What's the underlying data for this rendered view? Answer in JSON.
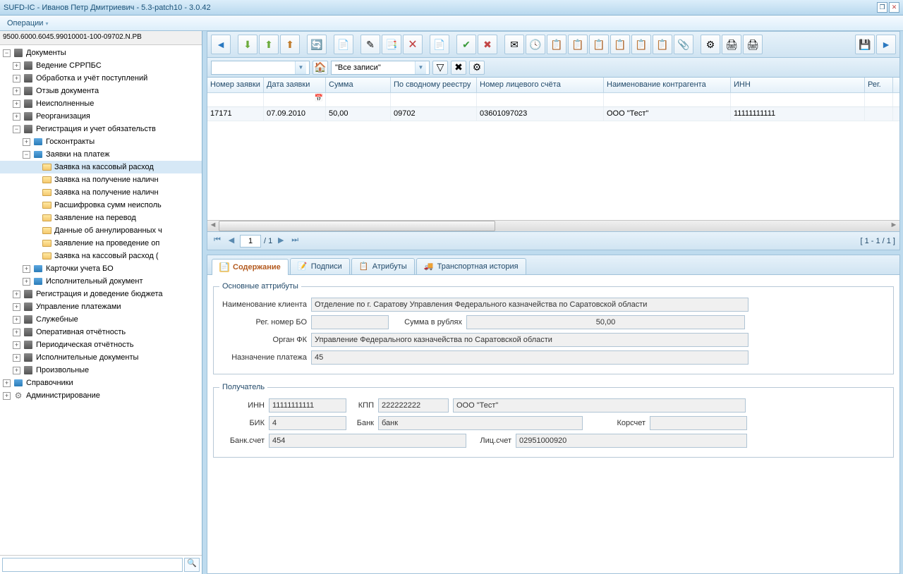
{
  "title": "SUFD-IC - Иванов Петр Дмитриевич - 5.3-patch10 - 3.0.42",
  "menu": {
    "operations": "Операции"
  },
  "tree": {
    "header": "9500.6000.6045.99010001-100-09702.N.PB",
    "root": "Документы",
    "admin": "Администрирование",
    "refs": "Справочники",
    "nodes": {
      "n1": "Ведение СРРПБС",
      "n2": "Обработка и учёт поступлений",
      "n3": "Отзыв документа",
      "n4": "Неисполненные",
      "n5": "Реорганизация",
      "n6": "Регистрация и учет обязательств",
      "n6a": "Госконтракты",
      "n6b": "Заявки на платеж",
      "n6b1": "Заявка на кассовый расход",
      "n6b2": "Заявка на получение наличн",
      "n6b3": "Заявка на получение наличн",
      "n6b4": "Расшифровка сумм неисполь",
      "n6b5": "Заявление на перевод",
      "n6b6": "Данные об аннулированных ч",
      "n6b7": "Заявление на проведение оп",
      "n6b8": "Заявка на кассовый расход (",
      "n6c": "Карточки учета БО",
      "n6d": "Исполнительный документ",
      "n7": "Регистрация и доведение бюджета",
      "n8": "Управление платежами",
      "n9": "Служебные",
      "n10": "Оперативная отчётность",
      "n11": "Периодическая отчётность",
      "n12": "Исполнительные документы",
      "n13": "Произвольные"
    }
  },
  "filter": {
    "allRecords": "\"Все записи\""
  },
  "grid": {
    "headers": {
      "num": "Номер заявки",
      "date": "Дата заявки",
      "sum": "Сумма",
      "reg": "По сводному реестру",
      "acct": "Номер лицевого счёта",
      "contr": "Наименование контрагента",
      "inn": "ИНН",
      "regcol": "Рег."
    },
    "row": {
      "num": "17171",
      "date": "07.09.2010",
      "sum": "50,00",
      "reg": "09702",
      "acct": "03601097023",
      "contr": "ООО \"Тест\"",
      "inn": "11111111111"
    }
  },
  "pager": {
    "page": "1",
    "of": "/ 1",
    "info": "[ 1 - 1 / 1 ]"
  },
  "tabs": {
    "t1": "Содержание",
    "t2": "Подписи",
    "t3": "Атрибуты",
    "t4": "Транспортная история"
  },
  "main": {
    "legend": "Основные аттрибуты",
    "clientLabel": "Наименование клиента",
    "client": "Отделение по г. Саратову Управления Федерального казначейства по Саратовской области",
    "regLabel": "Рег. номер БО",
    "reg": "",
    "sumLabel": "Сумма в рублях",
    "sum": "50,00",
    "organLabel": "Орган ФК",
    "organ": "Управление Федерального казначейства по Саратовской области",
    "purposeLabel": "Назначение платежа",
    "purpose": "45"
  },
  "rcpt": {
    "legend": "Получатель",
    "innLabel": "ИНН",
    "inn": "11111111111",
    "kppLabel": "КПП",
    "kpp": "222222222",
    "name": "ООО \"Тест\"",
    "bikLabel": "БИК",
    "bik": "4",
    "bankLabel": "Банк",
    "bank": "банк",
    "korLabel": "Корсчет",
    "kor": "",
    "bacctLabel": "Банк.счет",
    "bacct": "454",
    "lacctLabel": "Лиц.счет",
    "lacct": "02951000920"
  }
}
